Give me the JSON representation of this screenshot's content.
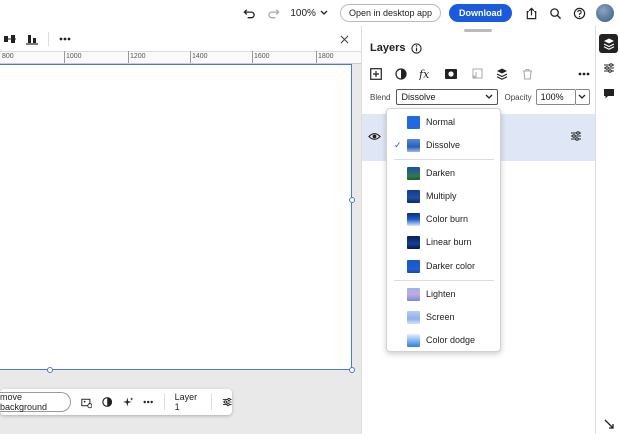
{
  "topbar": {
    "zoom": "100%",
    "open_desktop_label": "Open in desktop app",
    "download_label": "Download"
  },
  "ruler": {
    "ticks": [
      "800",
      "1000",
      "1200",
      "1400",
      "1600",
      "1800"
    ]
  },
  "context_bar": {
    "remove_bg_label": "move background",
    "layer_label": "Layer 1"
  },
  "panel": {
    "title": "Layers",
    "blend_label": "Blend",
    "blend_value": "Dissolve",
    "opacity_label": "Opacity",
    "opacity_value": "100%"
  },
  "menu": {
    "items": [
      {
        "label": "Normal",
        "checked": false
      },
      {
        "label": "Dissolve",
        "checked": true
      },
      {
        "label": "Darken",
        "checked": false
      },
      {
        "label": "Multiply",
        "checked": false
      },
      {
        "label": "Color burn",
        "checked": false
      },
      {
        "label": "Linear burn",
        "checked": false
      },
      {
        "label": "Darker color",
        "checked": false
      },
      {
        "label": "Lighten",
        "checked": false
      },
      {
        "label": "Screen",
        "checked": false
      },
      {
        "label": "Color dodge",
        "checked": false
      }
    ],
    "check_glyph": "✓"
  },
  "colors": {
    "accent": "#1a5bdc",
    "selection": "#4a7bd0",
    "layer_row": "#dfe6f5"
  }
}
